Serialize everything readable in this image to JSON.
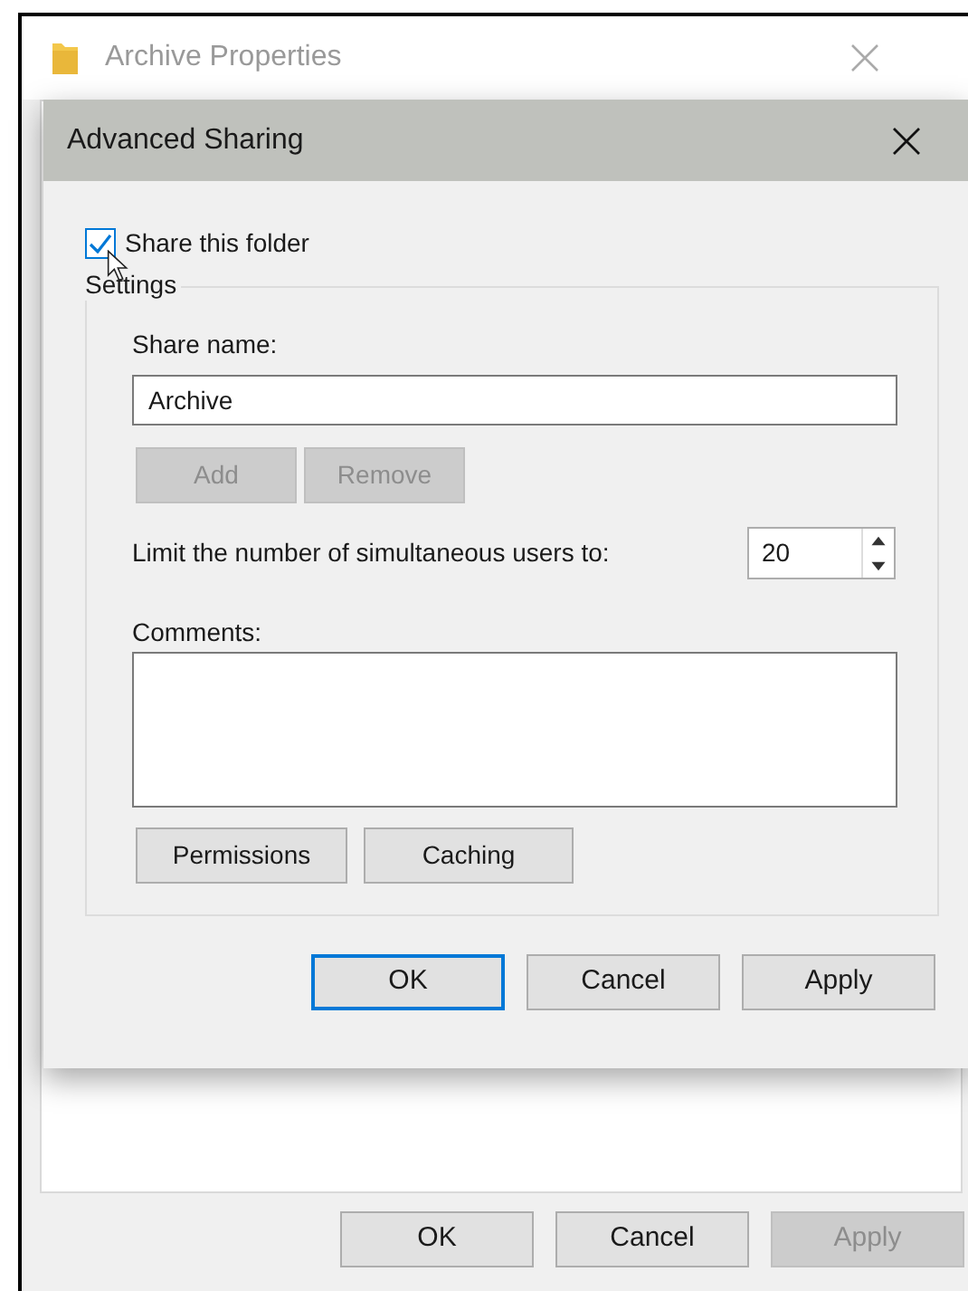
{
  "back_window": {
    "title": "Archive Properties",
    "buttons": [
      {
        "label": "OK",
        "disabled": false
      },
      {
        "label": "Cancel",
        "disabled": false
      },
      {
        "label": "Apply",
        "disabled": true
      }
    ]
  },
  "dialog": {
    "title": "Advanced Sharing",
    "share_checkbox": {
      "label": "Share this folder",
      "checked": true
    },
    "group_title": "Settings",
    "share_name_label": "Share name:",
    "share_name_value": "Archive",
    "name_buttons": [
      {
        "label": "Add",
        "disabled": true
      },
      {
        "label": "Remove",
        "disabled": true
      }
    ],
    "limit_label": "Limit the number of simultaneous users to:",
    "limit_value": "20",
    "comments_label": "Comments:",
    "option_buttons": [
      {
        "label": "Permissions",
        "disabled": false
      },
      {
        "label": "Caching",
        "disabled": false
      }
    ],
    "footer_buttons": [
      {
        "label": "OK",
        "default": true,
        "disabled": false
      },
      {
        "label": "Cancel",
        "default": false,
        "disabled": false
      },
      {
        "label": "Apply",
        "default": false,
        "disabled": false
      }
    ]
  }
}
